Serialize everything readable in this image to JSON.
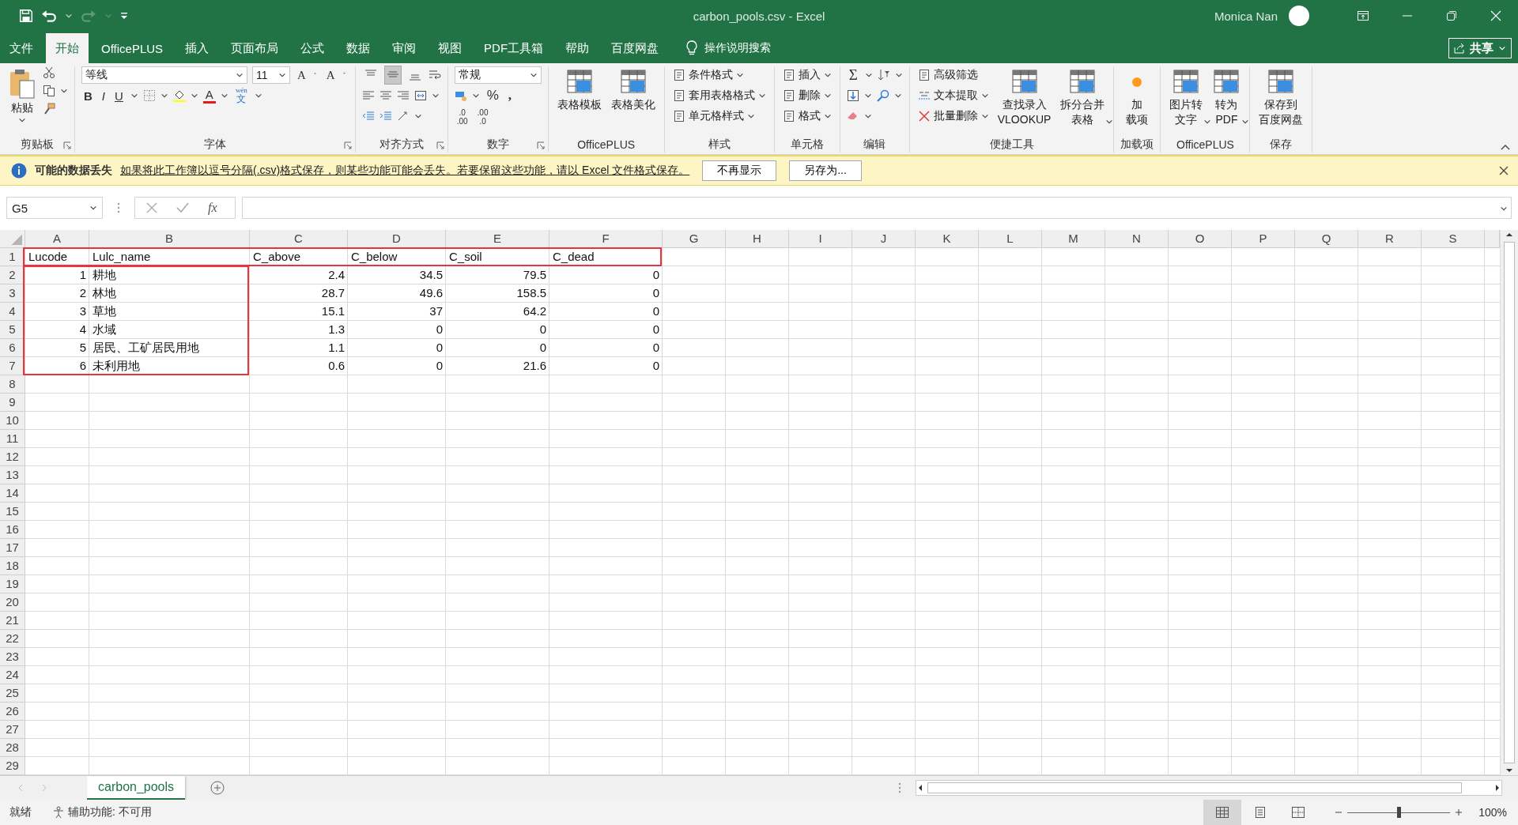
{
  "window": {
    "title": "carbon_pools.csv  -  Excel",
    "user": "Monica Nan"
  },
  "menu_tabs": [
    {
      "label": "文件",
      "selected": false
    },
    {
      "label": "开始",
      "selected": true
    },
    {
      "label": "OfficePLUS",
      "selected": false
    },
    {
      "label": "插入",
      "selected": false
    },
    {
      "label": "页面布局",
      "selected": false
    },
    {
      "label": "公式",
      "selected": false
    },
    {
      "label": "数据",
      "selected": false
    },
    {
      "label": "审阅",
      "selected": false
    },
    {
      "label": "视图",
      "selected": false
    },
    {
      "label": "PDF工具箱",
      "selected": false
    },
    {
      "label": "帮助",
      "selected": false
    },
    {
      "label": "百度网盘",
      "selected": false
    }
  ],
  "tell_me": "操作说明搜索",
  "share_button": "共享",
  "ribbon_groups": [
    {
      "kind": "clipboard",
      "label": "剪贴板",
      "launcher": true,
      "paste": "粘贴"
    },
    {
      "kind": "font",
      "label": "字体",
      "launcher": true,
      "font_name": "等线",
      "font_size": "11",
      "grow_font": "A",
      "shrink_font": "A",
      "style_buttons": [
        "B",
        "I",
        "U"
      ],
      "font_color": "A",
      "phonetic_top": "wén",
      "phonetic": "文"
    },
    {
      "kind": "alignment",
      "label": "对齐方式",
      "launcher": true,
      "toggles": [
        {
          "selected": false
        },
        {
          "selected": true
        },
        {
          "selected": false
        }
      ]
    },
    {
      "kind": "number",
      "label": "数字",
      "launcher": true,
      "format": "常规",
      "percent": "%",
      "comma": ",",
      "increase_decimal": [
        ".0",
        ".00"
      ],
      "decrease_decimal": [
        ".00",
        ".0"
      ]
    },
    {
      "kind": "large",
      "label": "OfficePLUS",
      "launcher": false,
      "buttons": [
        {
          "lines": [
            "表格模板"
          ],
          "dropdown": false
        },
        {
          "lines": [
            "表格美化"
          ],
          "dropdown": false
        }
      ]
    },
    {
      "kind": "stack",
      "label": "样式",
      "launcher": false,
      "buttons": [
        {
          "label": "条件格式",
          "dropdown": true
        },
        {
          "label": "套用表格格式",
          "dropdown": true
        },
        {
          "label": "单元格样式",
          "dropdown": true
        }
      ]
    },
    {
      "kind": "stack",
      "label": "单元格",
      "launcher": false,
      "buttons": [
        {
          "label": "插入",
          "dropdown": true
        },
        {
          "label": "删除",
          "dropdown": true
        },
        {
          "label": "格式",
          "dropdown": true
        }
      ]
    },
    {
      "kind": "editing",
      "label": "编辑",
      "launcher": false,
      "autosum": "Σ"
    },
    {
      "kind": "tools",
      "label": "便捷工具",
      "launcher": false,
      "buttons": [
        {
          "label": "高级筛选",
          "dropdown": false
        },
        {
          "label": "文本提取",
          "dropdown": true
        },
        {
          "label": "批量删除",
          "dropdown": true
        }
      ],
      "large_buttons": [
        {
          "lines": [
            "查找录入",
            "VLOOKUP"
          ],
          "dropdown": false
        },
        {
          "lines": [
            "拆分合并",
            "表格"
          ],
          "dropdown": true
        }
      ]
    },
    {
      "kind": "addin",
      "label": "加载项",
      "launcher": false,
      "buttons": [
        {
          "lines": [
            "加",
            "载项"
          ],
          "dropdown": false
        }
      ]
    },
    {
      "kind": "large",
      "label": "OfficePLUS",
      "launcher": false,
      "buttons": [
        {
          "lines": [
            "图片转",
            "文字"
          ],
          "dropdown": true
        },
        {
          "lines": [
            "转为",
            "PDF"
          ],
          "dropdown": true
        }
      ]
    },
    {
      "kind": "large",
      "label": "保存",
      "launcher": false,
      "buttons": [
        {
          "lines": [
            "保存到",
            "百度网盘"
          ],
          "dropdown": false
        }
      ]
    }
  ],
  "info_bar": {
    "title": "可能的数据丢失",
    "message": "如果将此工作簿以逗号分隔(.csv)格式保存，则某些功能可能会丢失。若要保留这些功能，请以 Excel 文件格式保存。",
    "buttons": [
      "不再显示",
      "另存为..."
    ]
  },
  "formula_bar": {
    "name_box": "G5",
    "function_label": "fx"
  },
  "sheet": {
    "columns": [
      "A",
      "B",
      "C",
      "D",
      "E",
      "F",
      "G",
      "H",
      "I",
      "J",
      "K",
      "L",
      "M",
      "N",
      "O",
      "P",
      "Q",
      "R",
      "S"
    ],
    "rows": [
      {
        "header": "1",
        "kind": "labels",
        "cells": [
          "Lucode",
          "Lulc_name",
          "C_above",
          "C_below",
          "C_soil",
          "C_dead"
        ]
      },
      {
        "header": "2",
        "kind": "values",
        "cells": [
          "1",
          "耕地",
          "2.4",
          "34.5",
          "79.5",
          "0"
        ]
      },
      {
        "header": "3",
        "kind": "values",
        "cells": [
          "2",
          "林地",
          "28.7",
          "49.6",
          "158.5",
          "0"
        ]
      },
      {
        "header": "4",
        "kind": "values",
        "cells": [
          "3",
          "草地",
          "15.1",
          "37",
          "64.2",
          "0"
        ]
      },
      {
        "header": "5",
        "kind": "values",
        "cells": [
          "4",
          "水域",
          "1.3",
          "0",
          "0",
          "0"
        ]
      },
      {
        "header": "6",
        "kind": "values",
        "cells": [
          "5",
          "居民、工矿居民用地",
          "1.1",
          "0",
          "0",
          "0"
        ]
      },
      {
        "header": "7",
        "kind": "values",
        "cells": [
          "6",
          "未利用地",
          "0.6",
          "0",
          "21.6",
          "0"
        ]
      },
      {
        "header": "8"
      },
      {
        "header": "9"
      },
      {
        "header": "10"
      },
      {
        "header": "11"
      },
      {
        "header": "12"
      },
      {
        "header": "13"
      },
      {
        "header": "14"
      },
      {
        "header": "15"
      },
      {
        "header": "16"
      },
      {
        "header": "17"
      },
      {
        "header": "18"
      },
      {
        "header": "19"
      },
      {
        "header": "20"
      },
      {
        "header": "21"
      },
      {
        "header": "22"
      },
      {
        "header": "23"
      },
      {
        "header": "24"
      },
      {
        "header": "25"
      },
      {
        "header": "26"
      },
      {
        "header": "27"
      },
      {
        "header": "28"
      },
      {
        "header": "29"
      }
    ]
  },
  "sheet_tabs": [
    {
      "label": "carbon_pools",
      "selected": true
    }
  ],
  "status_bar": {
    "ready": "就绪",
    "accessibility": "辅助功能: 不可用",
    "views": [
      {
        "selected": true
      },
      {
        "selected": false
      },
      {
        "selected": false
      }
    ],
    "zoom": {
      "level": 0.5
    },
    "zoom_label": "100%"
  }
}
